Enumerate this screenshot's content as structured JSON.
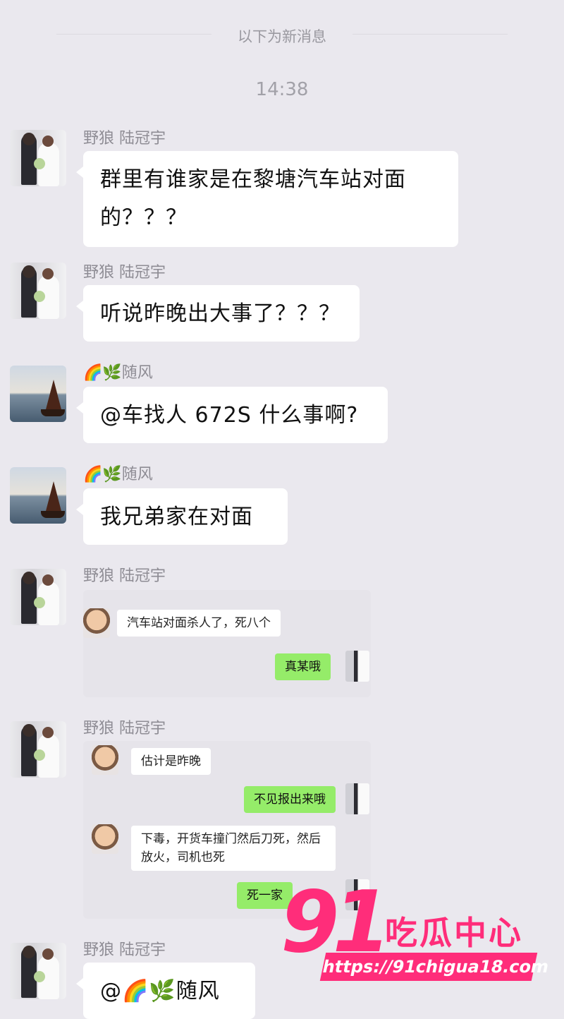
{
  "divider": {
    "label": "以下为新消息"
  },
  "timestamp": "14:38",
  "messages": [
    {
      "sender": "野狼 陆冠宇",
      "text_line1": "群里有谁家是在黎塘汽车站对面",
      "text_line2": "的？？？"
    },
    {
      "sender": "野狼 陆冠宇",
      "text": "听说昨晚出大事了？？？"
    },
    {
      "sender": "🌈🌿随风",
      "text": "@车找人 672S 什么事啊?"
    },
    {
      "sender": "🌈🌿随风",
      "text": "我兄弟家在对面"
    },
    {
      "sender": "野狼 陆冠宇",
      "image": {
        "left_msg": "汽车站对面杀人了，死八个",
        "right_msg": "真某哦"
      }
    },
    {
      "sender": "野狼 陆冠宇",
      "image": {
        "msg1": "估计是昨晚",
        "msg2": "不见报出来哦",
        "msg3_line1": "下毒，开货车撞门然后刀死，然后",
        "msg3_line2": "放火，司机也死",
        "msg4": "死一家"
      }
    },
    {
      "sender": "野狼 陆冠宇",
      "text": "@🌈🌿随风"
    }
  ],
  "watermark": {
    "number": "91",
    "name": "吃瓜中心",
    "url": "https://91chigua18.com"
  },
  "colors": {
    "background": "#eae8ee",
    "bubble": "#ffffff",
    "sent_bubble": "#95ec69",
    "watermark": "#ff2d7a"
  }
}
